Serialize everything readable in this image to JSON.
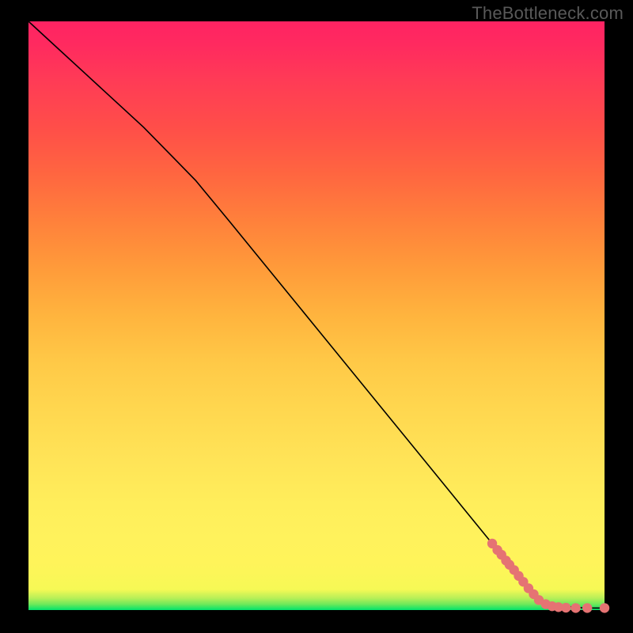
{
  "watermark": "TheBottleneck.com",
  "colors": {
    "dot": "#e57373",
    "line": "#000000"
  },
  "chart_data": {
    "type": "line",
    "title": "",
    "xlabel": "",
    "ylabel": "",
    "xlim": [
      0,
      100
    ],
    "ylim": [
      0,
      100
    ],
    "grid": false,
    "series": [
      {
        "name": "curve",
        "kind": "line",
        "x": [
          0,
          5,
          10,
          15,
          20,
          25,
          29,
          35,
          40,
          45,
          50,
          55,
          60,
          65,
          70,
          75,
          80,
          85,
          88,
          90,
          92,
          94,
          96,
          98,
          100
        ],
        "y": [
          100,
          95.5,
          91,
          86.5,
          82,
          77,
          73,
          65.9,
          59.9,
          53.9,
          47.9,
          41.9,
          35.9,
          29.9,
          23.9,
          17.9,
          11.9,
          5.9,
          2.3,
          1.3,
          0.8,
          0.55,
          0.4,
          0.35,
          0.35
        ]
      },
      {
        "name": "dots",
        "kind": "scatter",
        "x": [
          80.5,
          81.4,
          82.1,
          82.9,
          83.5,
          84.3,
          85.1,
          85.9,
          86.8,
          87.7,
          88.6,
          89.8,
          90.9,
          92.0,
          93.3,
          95.0,
          97.0,
          100.0
        ],
        "y": [
          11.3,
          10.2,
          9.4,
          8.4,
          7.7,
          6.8,
          5.8,
          4.8,
          3.7,
          2.7,
          1.7,
          1.0,
          0.65,
          0.5,
          0.4,
          0.35,
          0.35,
          0.35
        ]
      }
    ]
  }
}
